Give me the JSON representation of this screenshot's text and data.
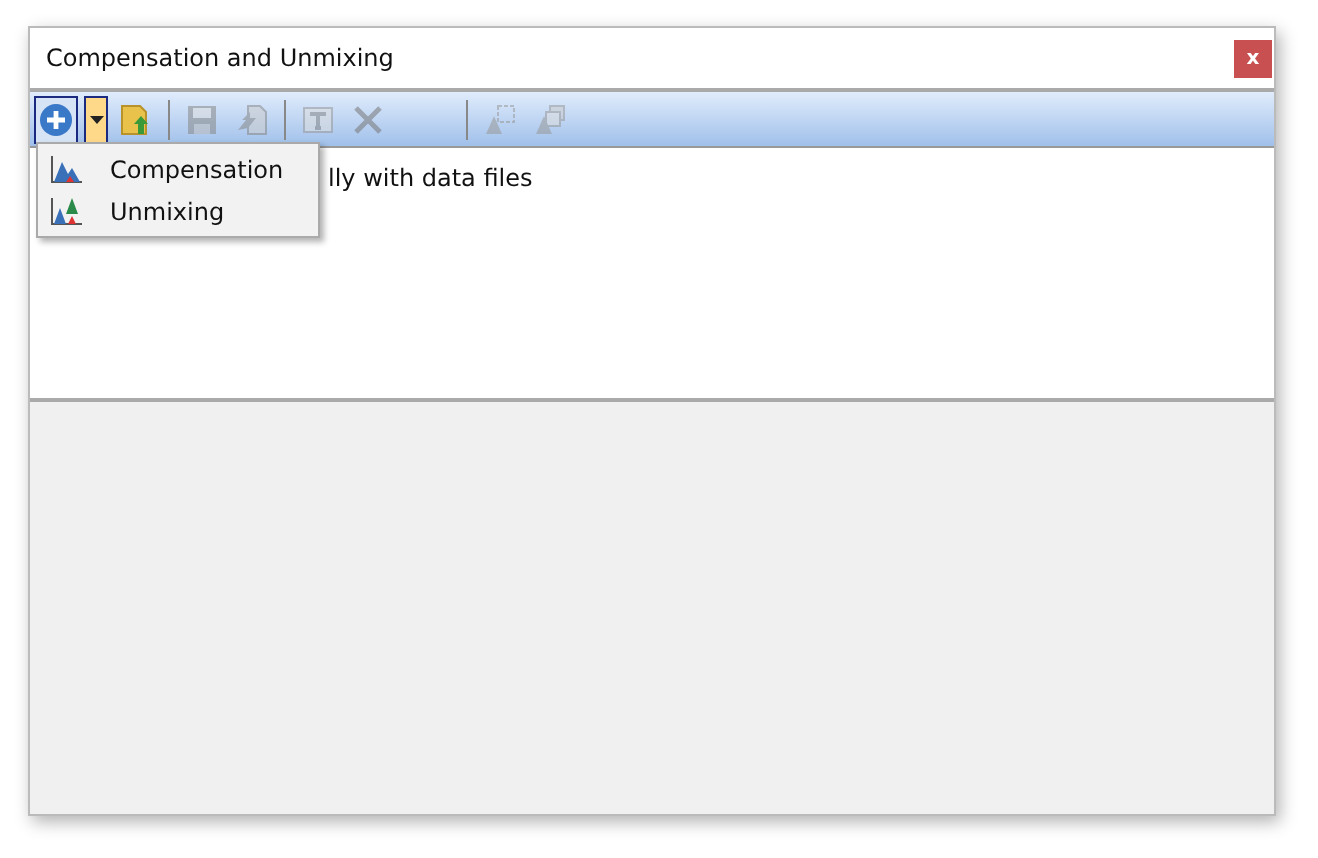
{
  "window": {
    "title": "Compensation and Unmixing",
    "close": "x"
  },
  "toolbar": [
    {
      "kind": "add",
      "disabled": false,
      "pressed": true
    },
    {
      "kind": "dropdown",
      "disabled": false,
      "pressed": true
    },
    {
      "kind": "import",
      "disabled": false,
      "pressed": false
    },
    {
      "kind": "separator"
    },
    {
      "kind": "save",
      "disabled": true,
      "pressed": false
    },
    {
      "kind": "export",
      "disabled": true,
      "pressed": false
    },
    {
      "kind": "separator"
    },
    {
      "kind": "text",
      "disabled": true,
      "pressed": false
    },
    {
      "kind": "delete",
      "disabled": true,
      "pressed": false
    },
    {
      "kind": "spacer"
    },
    {
      "kind": "separator"
    },
    {
      "kind": "copy",
      "disabled": true,
      "pressed": false
    },
    {
      "kind": "duplicate",
      "disabled": true,
      "pressed": false
    }
  ],
  "list": {
    "message": "lly with data files"
  },
  "menu": [
    {
      "kind": "compensation",
      "label": "Compensation"
    },
    {
      "kind": "unmixing",
      "label": "Unmixing"
    }
  ]
}
